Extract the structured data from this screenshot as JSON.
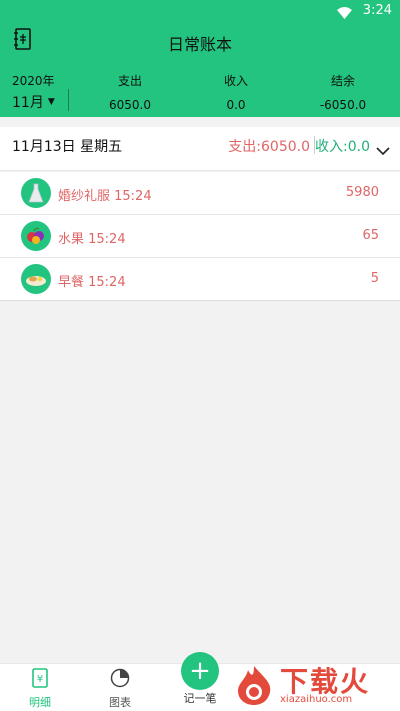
{
  "status": {
    "time": "3:24"
  },
  "appbar": {
    "title": "日常账本"
  },
  "summary": {
    "year": "2020年",
    "month": "11月",
    "expense_label": "支出",
    "expense_value": "6050.0",
    "income_label": "收入",
    "income_value": "0.0",
    "balance_label": "结余",
    "balance_value": "-6050.0"
  },
  "day": {
    "date": "11月13日 星期五",
    "expense": "支出:6050.0",
    "income": "收入:0.0"
  },
  "records": [
    {
      "name": "婚纱礼服 15:24",
      "amount": "5980",
      "icon": "wedding-dress-icon"
    },
    {
      "name": "水果 15:24",
      "amount": "65",
      "icon": "fruit-icon"
    },
    {
      "name": "早餐 15:24",
      "amount": "5",
      "icon": "breakfast-icon"
    }
  ],
  "nav": {
    "detail": "明细",
    "chart": "图表",
    "add": "记一笔"
  },
  "watermark": {
    "text": "下载火",
    "sub": "xiazaihuo.com"
  },
  "colors": {
    "primary": "#22c47f",
    "expense": "#e06666",
    "income": "#22b07a"
  }
}
